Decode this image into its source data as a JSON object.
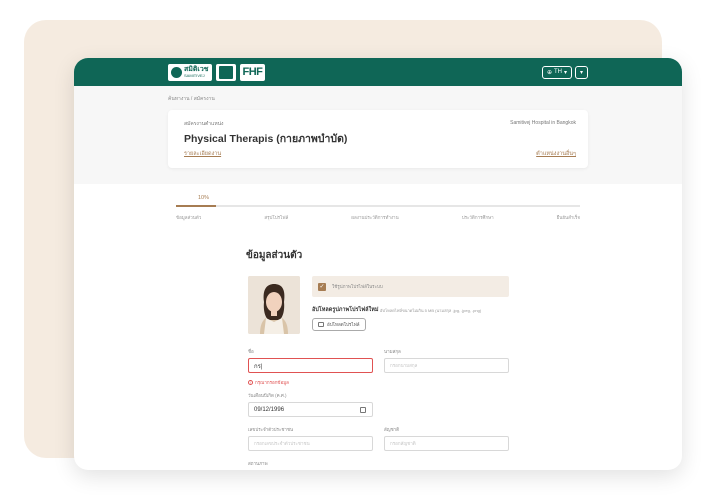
{
  "header": {
    "logos": {
      "samitivej_thai": "สมิติเวช",
      "samitivej_en": "SAMITIVEJ",
      "fhf": "FHF"
    },
    "lang_label": "TH",
    "breadcrumb": "ค้นหางาน / สมัครงาน"
  },
  "job": {
    "apply_label": "สมัครงานตำแหน่ง",
    "hospital": "Samitivej Hospital in Bangkok",
    "title": "Physical Therapis (กายภาพบำบัด)",
    "details_link": "รายละเอียดงาน",
    "other_link": "ตำแหน่งงานอื่นๆ"
  },
  "progress": {
    "percent_label": "10%",
    "percent": 10,
    "steps": [
      "ข้อมูลส่วนตัว",
      "สรุปโปรไฟล์",
      "ผลงานประวัติการทำงาน",
      "ประวัติการศึกษา",
      "ยืนยันสำเร็จ"
    ]
  },
  "form": {
    "section_title": "ข้อมูลส่วนตัว",
    "consent_label": "ใช้รูปภาพโปรไฟล์ในระบบ",
    "upload_title": "อัปโหลดรูปภาพโปรไฟล์ใหม่",
    "upload_note": "อัปโหลดไฟล์ขนาดไม่เกิน 5 MB (นามสกุล .jpg, .jpeg, .png)",
    "upload_button": "อัปโหลดโปรไฟล์",
    "first_name_label": "ชื่อ",
    "first_name_value": "กร|",
    "first_name_error": "กรุณากรอกข้อมูล",
    "last_name_label": "นามสกุล",
    "last_name_placeholder": "กรอกนามสกุล",
    "dob_label": "วันเดือนปีเกิด (ค.ศ.)",
    "dob_value": "09/12/1996",
    "id_label": "เลขประจำตัวประชาชน",
    "id_placeholder": "กรอกเลขประจำตัวประชาชน",
    "nationality_label": "สัญชาติ",
    "nationality_placeholder": "กรอกสัญชาติ",
    "status_label": "สถานภาพ"
  },
  "colors": {
    "brand_green": "#0f6656",
    "accent_brown": "#a67c52",
    "error_red": "#e05252"
  }
}
